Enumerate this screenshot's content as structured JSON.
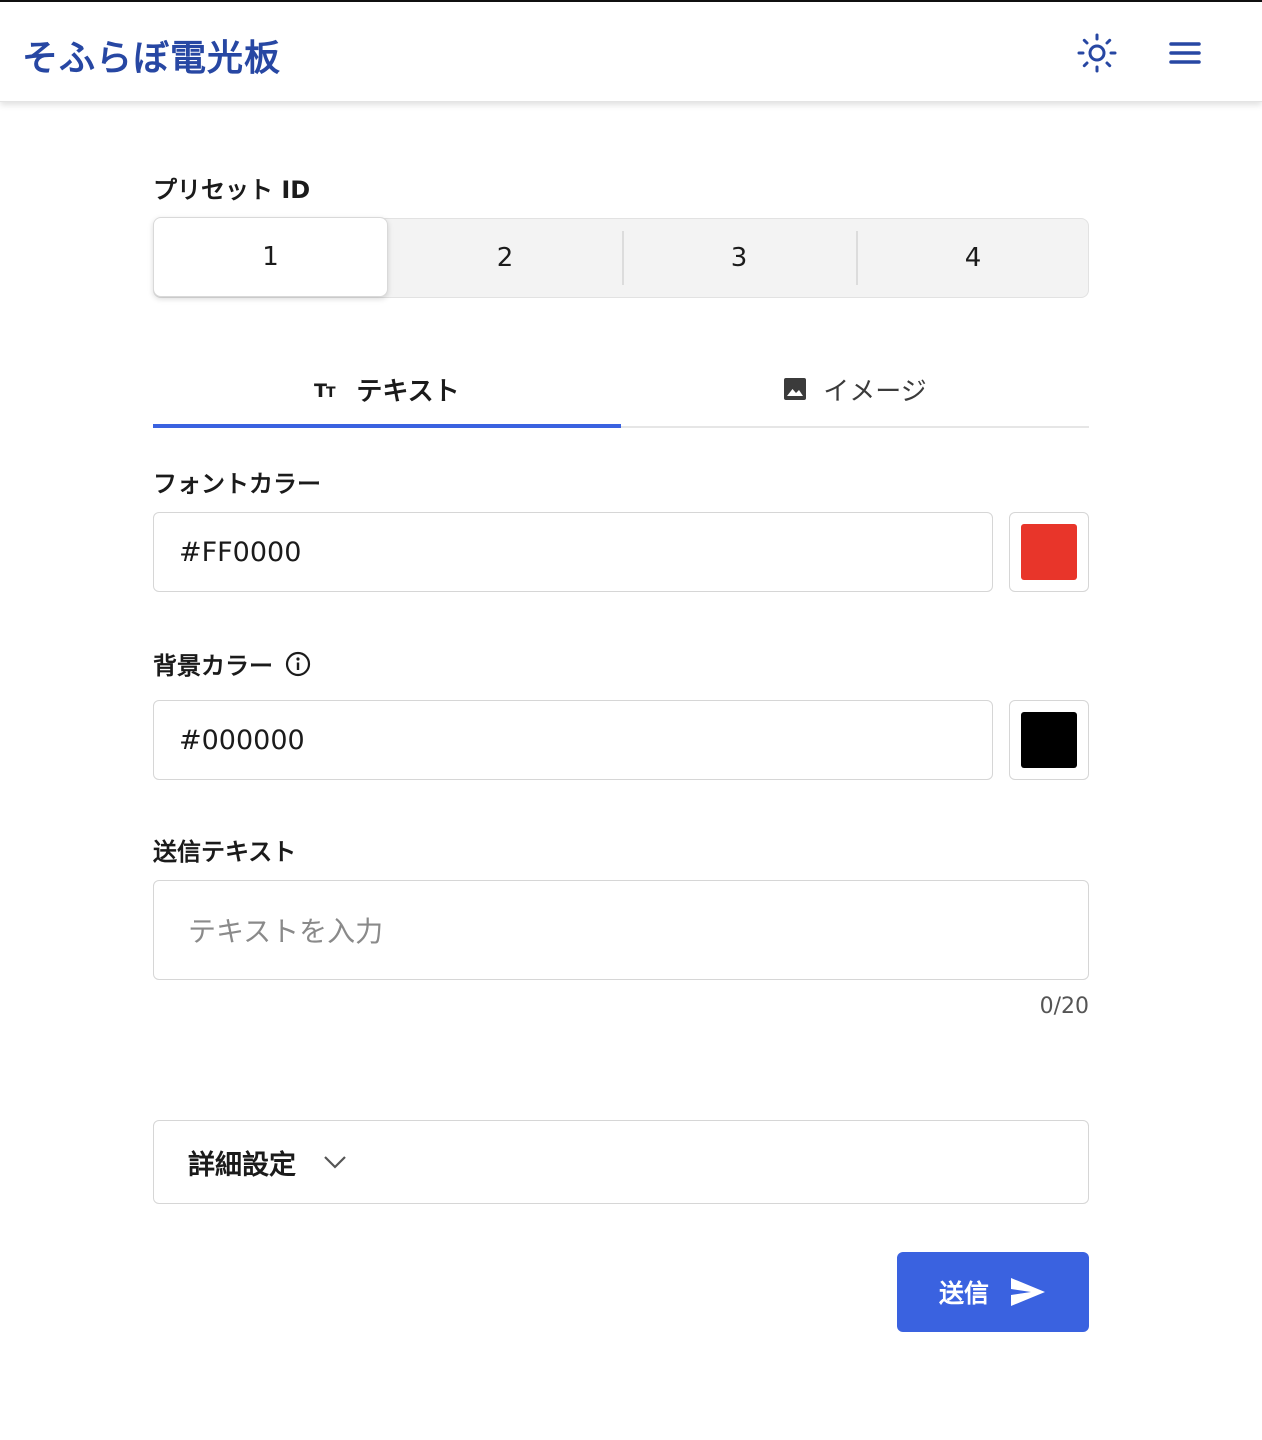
{
  "header": {
    "title": "そふらぼ電光板",
    "theme_icon": "sun-icon",
    "menu_icon": "hamburger-menu-icon",
    "accent_color": "#2747a3"
  },
  "preset": {
    "label": "プリセット ID",
    "options": [
      "1",
      "2",
      "3",
      "4"
    ],
    "selected": "1"
  },
  "tabs": [
    {
      "label": "テキスト",
      "icon": "text-format-icon",
      "active": true
    },
    {
      "label": "イメージ",
      "icon": "image-icon",
      "active": false
    }
  ],
  "font_color": {
    "label": "フォントカラー",
    "value": "#FF0000",
    "swatch": "#E8352A"
  },
  "bg_color": {
    "label": "背景カラー",
    "info_icon": "info-icon",
    "value": "#000000",
    "swatch": "#000000"
  },
  "send_text": {
    "label": "送信テキスト",
    "placeholder": "テキストを入力",
    "counter": "0/20"
  },
  "details": {
    "label": "詳細設定",
    "icon": "chevron-down-icon"
  },
  "send_button": {
    "label": "送信",
    "icon": "send-icon",
    "color": "#3A62E0"
  }
}
